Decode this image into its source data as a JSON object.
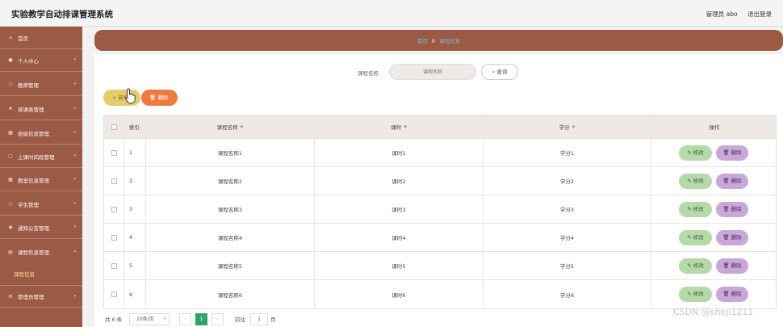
{
  "app": {
    "title": "实验教学自动排课管理系统",
    "user": "管理员 abo",
    "logout": "退出登录"
  },
  "sidebar": {
    "items": [
      {
        "label": "首页",
        "icon": "home-icon"
      },
      {
        "label": "个人中心",
        "icon": "user-icon"
      },
      {
        "label": "教师管理",
        "icon": "teacher-icon"
      },
      {
        "label": "排课表管理",
        "icon": "star-icon"
      },
      {
        "label": "班级信息管理",
        "icon": "grid-icon"
      },
      {
        "label": "上课时间段管理",
        "icon": "document-icon"
      },
      {
        "label": "教室信息管理",
        "icon": "grid-icon"
      },
      {
        "label": "学生管理",
        "icon": "student-icon"
      },
      {
        "label": "通知公告管理",
        "icon": "bell-icon"
      },
      {
        "label": "课程信息管理",
        "icon": "book-icon"
      },
      {
        "label": "管理员管理",
        "icon": "settings-icon"
      }
    ],
    "active_sub": "课程信息"
  },
  "breadcrumb": {
    "home": "首页",
    "separator": "0",
    "current": "课程信息"
  },
  "search": {
    "label": "课程名称",
    "placeholder": "课程名称",
    "button": "查询"
  },
  "toolbar": {
    "add": "新增",
    "delete": "删除"
  },
  "table": {
    "headers": {
      "index": "索引",
      "name": "课程名称",
      "hours": "课时",
      "credit": "学分",
      "ops": "操作"
    },
    "rows": [
      {
        "index": "1",
        "name": "课程名称1",
        "hours": "课时1",
        "credit": "学分1"
      },
      {
        "index": "2",
        "name": "课程名称2",
        "hours": "课时2",
        "credit": "学分2"
      },
      {
        "index": "3",
        "name": "课程名称3",
        "hours": "课时3",
        "credit": "学分3"
      },
      {
        "index": "4",
        "name": "课程名称4",
        "hours": "课时4",
        "credit": "学分4"
      },
      {
        "index": "5",
        "name": "课程名称5",
        "hours": "课时5",
        "credit": "学分5"
      },
      {
        "index": "6",
        "name": "课程名称6",
        "hours": "课时6",
        "credit": "学分6"
      }
    ],
    "edit_label": "修改",
    "delete_label": "删除"
  },
  "pagination": {
    "total": "共 6 条",
    "page_size": "10条/页",
    "current_page": "1",
    "goto_label": "前往",
    "goto_value": "1",
    "page_unit": "页"
  },
  "watermark": "CSDN @sheji1211",
  "colors": {
    "sidebar": "#9a5a43",
    "add": "#e2cc6b",
    "delete": "#ee7a3d",
    "edit": "#b5d9a9",
    "row_delete": "#c7a8d9",
    "page_active": "#2ea36b"
  }
}
